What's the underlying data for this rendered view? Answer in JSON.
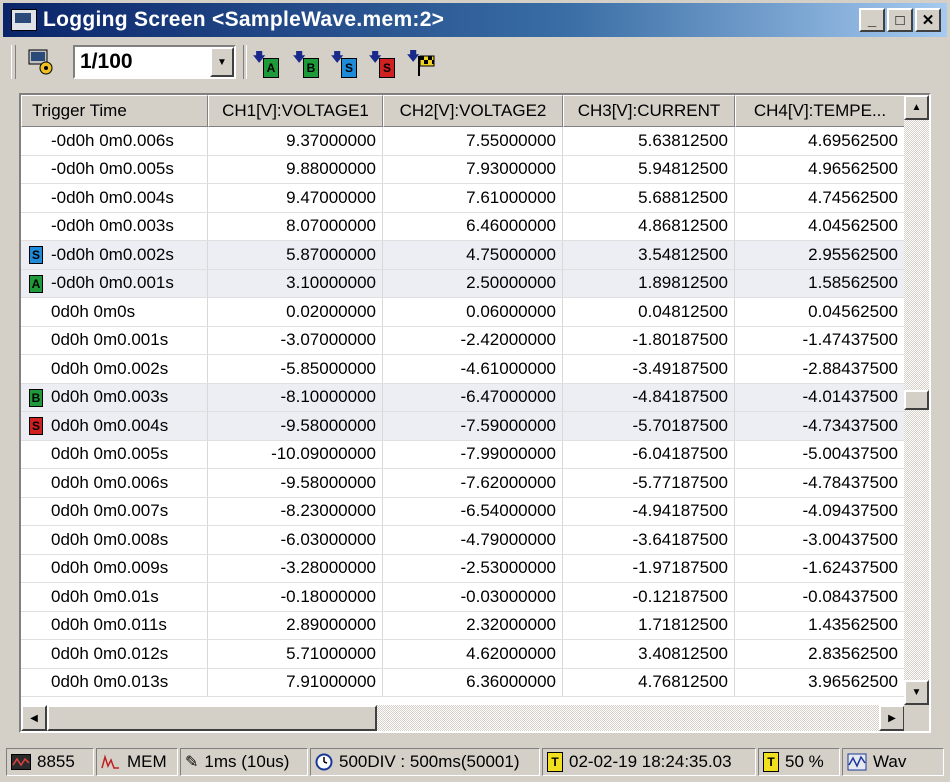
{
  "window": {
    "title": "Logging Screen <SampleWave.mem:2>",
    "minimize_glyph": "_",
    "maximize_glyph": "□",
    "close_glyph": "✕"
  },
  "toolbar": {
    "settings_icon": "logging-settings-icon",
    "ratio_value": "1/100",
    "marker_buttons": [
      {
        "label": "A",
        "color": "#1f9a3a"
      },
      {
        "label": "B",
        "color": "#1f9a3a"
      },
      {
        "label": "S",
        "color": "#1f8ad8"
      },
      {
        "label": "S",
        "color": "#d02020"
      }
    ],
    "flag_icon": "checkered-flag-icon"
  },
  "table": {
    "columns": [
      "Trigger Time",
      "CH1[V]:VOLTAGE1",
      "CH2[V]:VOLTAGE2",
      "CH3[V]:CURRENT",
      "CH4[V]:TEMPE..."
    ],
    "rows": [
      {
        "time": "-0d0h 0m0.006s",
        "ch1": "9.37000000",
        "ch2": "7.55000000",
        "ch3": "5.63812500",
        "ch4": "4.69562500",
        "marker": "",
        "marker_color": ""
      },
      {
        "time": "-0d0h 0m0.005s",
        "ch1": "9.88000000",
        "ch2": "7.93000000",
        "ch3": "5.94812500",
        "ch4": "4.96562500",
        "marker": "",
        "marker_color": ""
      },
      {
        "time": "-0d0h 0m0.004s",
        "ch1": "9.47000000",
        "ch2": "7.61000000",
        "ch3": "5.68812500",
        "ch4": "4.74562500",
        "marker": "",
        "marker_color": ""
      },
      {
        "time": "-0d0h 0m0.003s",
        "ch1": "8.07000000",
        "ch2": "6.46000000",
        "ch3": "4.86812500",
        "ch4": "4.04562500",
        "marker": "",
        "marker_color": ""
      },
      {
        "time": "-0d0h 0m0.002s",
        "ch1": "5.87000000",
        "ch2": "4.75000000",
        "ch3": "3.54812500",
        "ch4": "2.95562500",
        "marker": "S",
        "marker_color": "#1f8ad8"
      },
      {
        "time": "-0d0h 0m0.001s",
        "ch1": "3.10000000",
        "ch2": "2.50000000",
        "ch3": "1.89812500",
        "ch4": "1.58562500",
        "marker": "A",
        "marker_color": "#1f9a3a"
      },
      {
        "time": "0d0h 0m0s",
        "ch1": "0.02000000",
        "ch2": "0.06000000",
        "ch3": "0.04812500",
        "ch4": "0.04562500",
        "marker": "",
        "marker_color": ""
      },
      {
        "time": "0d0h 0m0.001s",
        "ch1": "-3.07000000",
        "ch2": "-2.42000000",
        "ch3": "-1.80187500",
        "ch4": "-1.47437500",
        "marker": "",
        "marker_color": ""
      },
      {
        "time": "0d0h 0m0.002s",
        "ch1": "-5.85000000",
        "ch2": "-4.61000000",
        "ch3": "-3.49187500",
        "ch4": "-2.88437500",
        "marker": "",
        "marker_color": ""
      },
      {
        "time": "0d0h 0m0.003s",
        "ch1": "-8.10000000",
        "ch2": "-6.47000000",
        "ch3": "-4.84187500",
        "ch4": "-4.01437500",
        "marker": "B",
        "marker_color": "#1f9a3a"
      },
      {
        "time": "0d0h 0m0.004s",
        "ch1": "-9.58000000",
        "ch2": "-7.59000000",
        "ch3": "-5.70187500",
        "ch4": "-4.73437500",
        "marker": "S",
        "marker_color": "#d02020"
      },
      {
        "time": "0d0h 0m0.005s",
        "ch1": "-10.09000000",
        "ch2": "-7.99000000",
        "ch3": "-6.04187500",
        "ch4": "-5.00437500",
        "marker": "",
        "marker_color": ""
      },
      {
        "time": "0d0h 0m0.006s",
        "ch1": "-9.58000000",
        "ch2": "-7.62000000",
        "ch3": "-5.77187500",
        "ch4": "-4.78437500",
        "marker": "",
        "marker_color": ""
      },
      {
        "time": "0d0h 0m0.007s",
        "ch1": "-8.23000000",
        "ch2": "-6.54000000",
        "ch3": "-4.94187500",
        "ch4": "-4.09437500",
        "marker": "",
        "marker_color": ""
      },
      {
        "time": "0d0h 0m0.008s",
        "ch1": "-6.03000000",
        "ch2": "-4.79000000",
        "ch3": "-3.64187500",
        "ch4": "-3.00437500",
        "marker": "",
        "marker_color": ""
      },
      {
        "time": "0d0h 0m0.009s",
        "ch1": "-3.28000000",
        "ch2": "-2.53000000",
        "ch3": "-1.97187500",
        "ch4": "-1.62437500",
        "marker": "",
        "marker_color": ""
      },
      {
        "time": "0d0h 0m0.01s",
        "ch1": "-0.18000000",
        "ch2": "-0.03000000",
        "ch3": "-0.12187500",
        "ch4": "-0.08437500",
        "marker": "",
        "marker_color": ""
      },
      {
        "time": "0d0h 0m0.011s",
        "ch1": "2.89000000",
        "ch2": "2.32000000",
        "ch3": "1.71812500",
        "ch4": "1.43562500",
        "marker": "",
        "marker_color": ""
      },
      {
        "time": "0d0h 0m0.012s",
        "ch1": "5.71000000",
        "ch2": "4.62000000",
        "ch3": "3.40812500",
        "ch4": "2.83562500",
        "marker": "",
        "marker_color": ""
      },
      {
        "time": "0d0h 0m0.013s",
        "ch1": "7.91000000",
        "ch2": "6.36000000",
        "ch3": "4.76812500",
        "ch4": "3.96562500",
        "marker": "",
        "marker_color": ""
      }
    ],
    "highlight_rows": [
      4,
      5,
      9,
      10
    ]
  },
  "status": {
    "model": "8855",
    "mode": "MEM",
    "sampling": "1ms (10us)",
    "length": "500DIV : 500ms(50001)",
    "trigger_time": "02-02-19 18:24:35.03",
    "pretrigger": "50 %",
    "wave": "Wav"
  }
}
